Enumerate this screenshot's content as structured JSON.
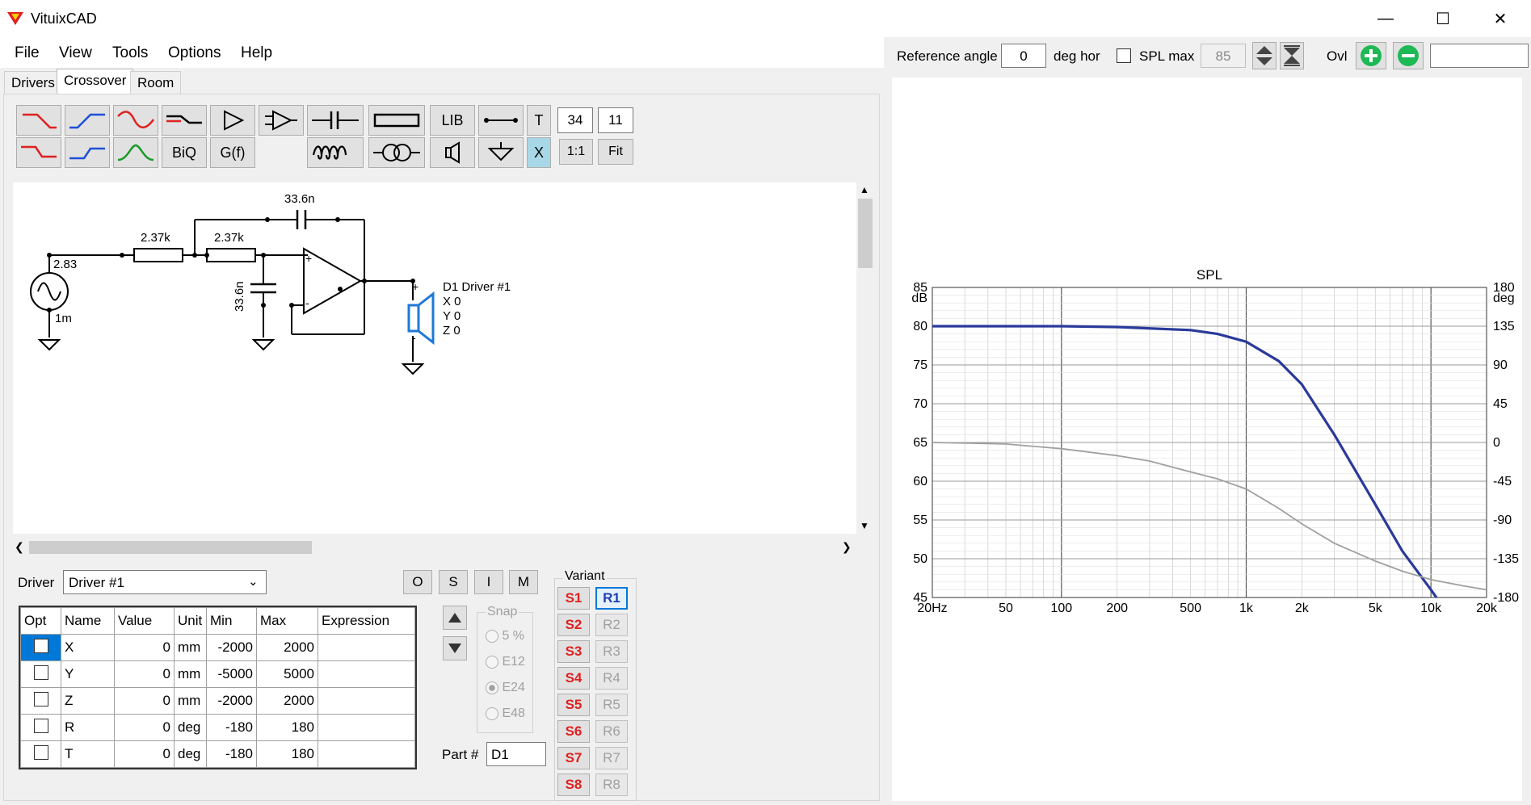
{
  "window": {
    "title": "VituixCAD",
    "colors": {
      "accent": "#0078d7",
      "red": "#e02020",
      "blue": "#2a3a9a"
    }
  },
  "menu": [
    "File",
    "View",
    "Tools",
    "Options",
    "Help"
  ],
  "tabs": [
    "Drivers",
    "Crossover",
    "Room"
  ],
  "toolbar": {
    "biq": "BiQ",
    "gf": "G(f)",
    "lib": "LIB",
    "t": "T",
    "x": "X",
    "one_to_one": "1:1",
    "fit": "Fit",
    "box1": "34",
    "box2": "11"
  },
  "schematic": {
    "source_v": "2.83",
    "source_r": "1m",
    "r1": "2.37k",
    "r2": "2.37k",
    "c1": "33.6n",
    "c2": "33.6n",
    "driver_name": "D1 Driver #1",
    "dx": "X 0",
    "dy": "Y 0",
    "dz": "Z 0",
    "plus": "+",
    "minus": "-"
  },
  "driver_panel": {
    "label": "Driver",
    "selected": "Driver #1",
    "btns": [
      "O",
      "S",
      "I",
      "M"
    ],
    "columns": [
      "Opt",
      "Name",
      "Value",
      "Unit",
      "Min",
      "Max",
      "Expression"
    ],
    "rows": [
      {
        "name": "X",
        "value": "0",
        "unit": "mm",
        "min": "-2000",
        "max": "2000"
      },
      {
        "name": "Y",
        "value": "0",
        "unit": "mm",
        "min": "-5000",
        "max": "5000"
      },
      {
        "name": "Z",
        "value": "0",
        "unit": "mm",
        "min": "-2000",
        "max": "2000"
      },
      {
        "name": "R",
        "value": "0",
        "unit": "deg",
        "min": "-180",
        "max": "180"
      },
      {
        "name": "T",
        "value": "0",
        "unit": "deg",
        "min": "-180",
        "max": "180"
      }
    ],
    "snap": {
      "label": "Snap",
      "options": [
        "5 %",
        "E12",
        "E24",
        "E48"
      ],
      "selected": "E24"
    },
    "part_label": "Part #",
    "part_value": "D1"
  },
  "variant": {
    "label": "Variant",
    "s": [
      "S1",
      "S2",
      "S3",
      "S4",
      "S5",
      "S6",
      "S7",
      "S8"
    ],
    "r": [
      "R1",
      "R2",
      "R3",
      "R4",
      "R5",
      "R6",
      "R7",
      "R8"
    ]
  },
  "right_toolbar": {
    "ref_label": "Reference angle",
    "ref_value": "0",
    "deg_hor": "deg hor",
    "splmax_label": "SPL max",
    "splmax_value": "85",
    "ovl": "Ovl"
  },
  "chart_data": {
    "type": "line",
    "title": "SPL",
    "ylabel_left": "dB",
    "ylabel_right": "deg",
    "x_scale": "log",
    "xlim": [
      20,
      20000
    ],
    "ylim": [
      45,
      85
    ],
    "ylim_right": [
      -180,
      180
    ],
    "x_ticks": [
      "20Hz",
      "50",
      "100",
      "200",
      "500",
      "1k",
      "2k",
      "5k",
      "10k",
      "20k"
    ],
    "y_ticks": [
      "45",
      "50",
      "55",
      "60",
      "65",
      "70",
      "75",
      "80",
      "85"
    ],
    "y_ticks_right": [
      "-180",
      "-135",
      "-90",
      "-45",
      "0",
      "45",
      "90",
      "135",
      "180"
    ],
    "grid": true,
    "series": [
      {
        "color": "#2a3a9a",
        "x": [
          20,
          50,
          100,
          200,
          500,
          700,
          1000,
          1500,
          2000,
          3000,
          5000,
          7000,
          10000,
          15000
        ],
        "y": [
          80,
          80,
          80,
          79.9,
          79.5,
          79,
          78,
          75.5,
          72.5,
          66,
          57,
          51,
          46,
          40
        ]
      },
      {
        "color": "#a0a0a0",
        "x": [
          20,
          50,
          100,
          200,
          300,
          500,
          700,
          1000,
          1500,
          2000,
          3000,
          5000,
          7000,
          10000,
          15000,
          20000
        ],
        "y": [
          65,
          64.8,
          64.2,
          63.3,
          62.6,
          61.2,
          60.3,
          59,
          56.5,
          54.5,
          52,
          49.7,
          48.4,
          47.3,
          46.5,
          46
        ]
      }
    ]
  }
}
